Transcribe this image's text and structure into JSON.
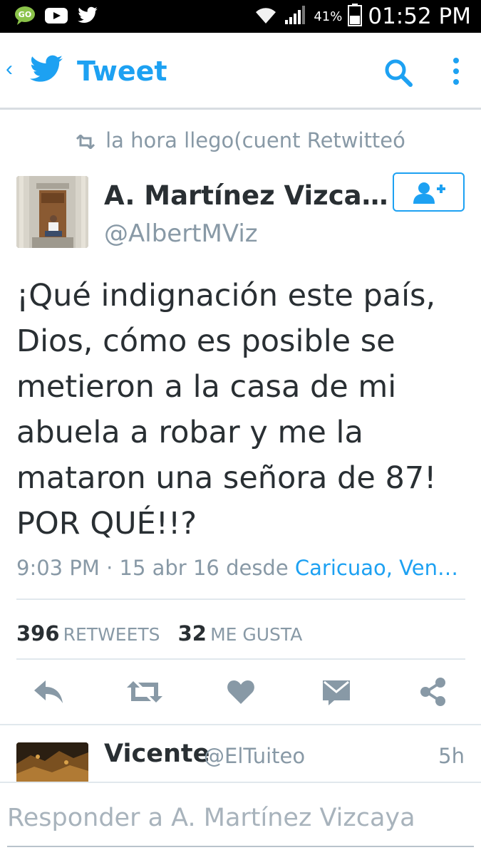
{
  "status_bar": {
    "time": "01:52 PM",
    "battery_percent": "41%",
    "icons": [
      "go-sms-icon",
      "youtube-icon",
      "twitter-icon",
      "wifi-icon",
      "signal-icon",
      "battery-icon"
    ]
  },
  "toolbar": {
    "back_glyph": "‹",
    "title": "Tweet",
    "icons": [
      "twitter-bird-icon",
      "search-icon",
      "more-vert-icon"
    ]
  },
  "retweet_context": "la hora llego(cuent Retwitteó",
  "author": {
    "name": "A. Martínez Vizca…",
    "handle": "@AlbertMViz"
  },
  "tweet": {
    "text": "¡Qué indignación este país,\nDios, cómo es posible se\nmetieron a la casa de mi\nabuela a robar y me la\nmataron una señora de 87!\nPOR QUÉ!!?",
    "time_date": "9:03 PM · 15 abr 16 desde ",
    "location": "Caricuao, Ven…"
  },
  "stats": {
    "retweets_count": "396",
    "retweets_label": "RETWEETS",
    "likes_count": "32",
    "likes_label": "ME GUSTA"
  },
  "actions": [
    "reply-icon",
    "retweet-icon",
    "like-icon",
    "direct-message-icon",
    "share-icon"
  ],
  "reply_preview": {
    "name": "Vicente",
    "handle": "@ElTuiteo",
    "time": "5h"
  },
  "composer": {
    "placeholder": "Responder a A. Martínez Vizcaya",
    "value": ""
  },
  "colors": {
    "accent": "#1da1f2",
    "text": "#292f33",
    "muted": "#8899a6",
    "divider": "#e1e8ed"
  }
}
